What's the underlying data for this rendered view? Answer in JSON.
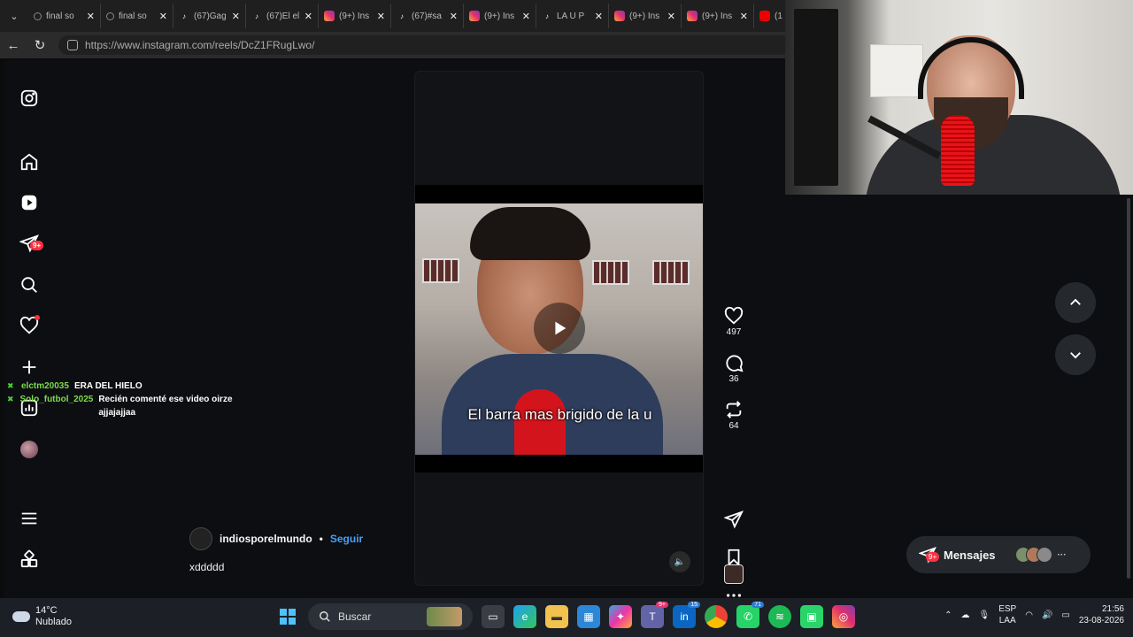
{
  "browser": {
    "tabs": [
      {
        "title": "final so",
        "icon": "search-icon"
      },
      {
        "title": "final so",
        "icon": "search-icon"
      },
      {
        "title": "(67)Gag",
        "icon": "tiktok-icon"
      },
      {
        "title": "(67)El el",
        "icon": "tiktok-icon"
      },
      {
        "title": "(9+) Ins",
        "icon": "instagram-icon"
      },
      {
        "title": "(67)#sa",
        "icon": "tiktok-icon"
      },
      {
        "title": "(9+) Ins",
        "icon": "instagram-icon"
      },
      {
        "title": "LA U P",
        "icon": "tiktok-icon"
      },
      {
        "title": "(9+) Ins",
        "icon": "instagram-icon"
      },
      {
        "title": "(9+) Ins",
        "icon": "instagram-icon"
      },
      {
        "title": "(1",
        "icon": "youtube-icon"
      }
    ],
    "url": "https://www.instagram.com/reels/DcZ1FRugLwo/",
    "close_glyph": "✕"
  },
  "sidebar": {
    "messages_badge": "9+"
  },
  "chat": [
    {
      "user": "elctm20035",
      "message": "ERA DEL HIELO"
    },
    {
      "user": "Solo_futbol_2025",
      "message": "Recién comenté ese video oirze ajjajajjaa"
    }
  ],
  "reel": {
    "caption": "El barra mas brigido de la u",
    "likes": "497",
    "comments": "36",
    "reposts": "64",
    "author": "indiosporelmundo",
    "separator": "•",
    "follow_label": "Seguir",
    "description": "xddddd"
  },
  "messages_pill": {
    "label": "Mensajes",
    "badge": "9+"
  },
  "taskbar": {
    "temperature": "14°C",
    "condition": "Nublado",
    "search_label": "Buscar",
    "teams_badge": "9+",
    "linkedin_badge": "15",
    "whatsapp_badge": "71",
    "lang_primary": "ESP",
    "lang_secondary": "LAA",
    "time": "21:56",
    "date": "23-08-2026"
  },
  "colors": {
    "instagram_red": "#ff3040",
    "follow_blue": "#4a9ff5",
    "chat_user_green": "#7ddb4a"
  }
}
